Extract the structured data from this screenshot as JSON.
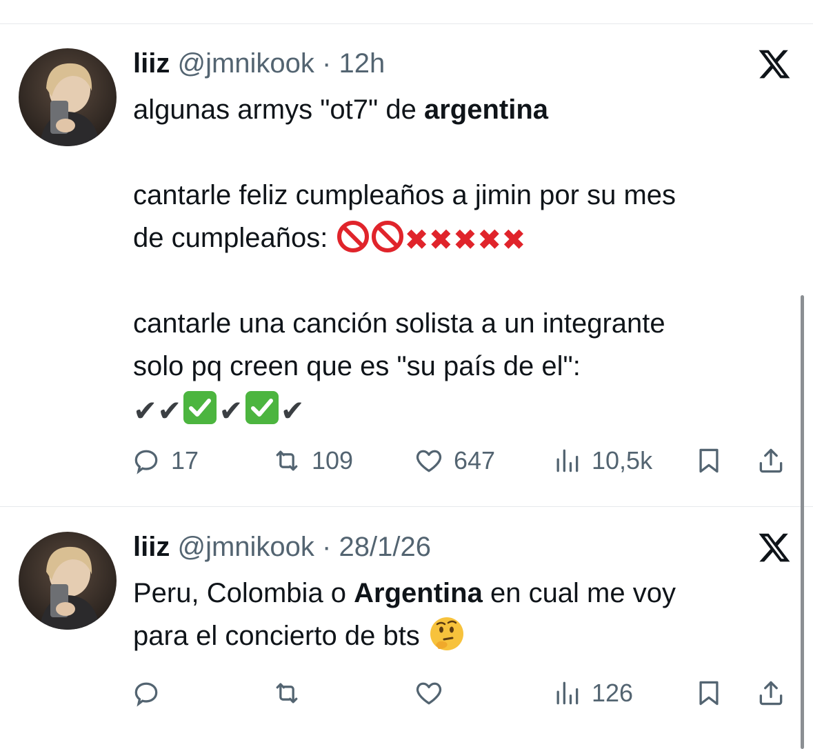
{
  "tweets": [
    {
      "name": "liiz",
      "handle": "@jmnikook",
      "dot": "·",
      "time": "12h",
      "text": {
        "l1_pre": "algunas armys \"ot7\" de ",
        "l1_bold": "argentina",
        "l2": "cantarle feliz cumpleaños a jimin por su mes",
        "l3_pre": "de cumpleaños: ",
        "l4": "cantarle una canción solista a un integrante",
        "l5": "solo pq creen que es \"su país de el\":",
        "check": "✔"
      },
      "actions": {
        "replies": "17",
        "reposts": "109",
        "likes": "647",
        "views": "10,5k"
      }
    },
    {
      "name": "liiz",
      "handle": "@jmnikook",
      "dot": "·",
      "time": "28/1/26",
      "text": {
        "l1_pre": "Peru, Colombia o ",
        "l1_bold": "Argentina",
        "l1_post": " en cual me voy",
        "l2": "para el concierto de bts "
      },
      "actions": {
        "views": "126"
      }
    }
  ],
  "icons": {
    "reply": "reply-icon",
    "repost": "repost-icon",
    "like": "heart-icon",
    "views": "views-icon",
    "bookmark": "bookmark-icon",
    "share": "share-icon",
    "x": "x-logo-icon"
  },
  "emojis_tweet1_line3": [
    "🚫",
    "🚫",
    "❌",
    "❌",
    "❌",
    "❌",
    "❌"
  ],
  "emojis_tweet1_line6": [
    "✔",
    "✔",
    "✅",
    "✔",
    "✅",
    "✔"
  ],
  "emojis_tweet2_line2": [
    "🤔"
  ]
}
